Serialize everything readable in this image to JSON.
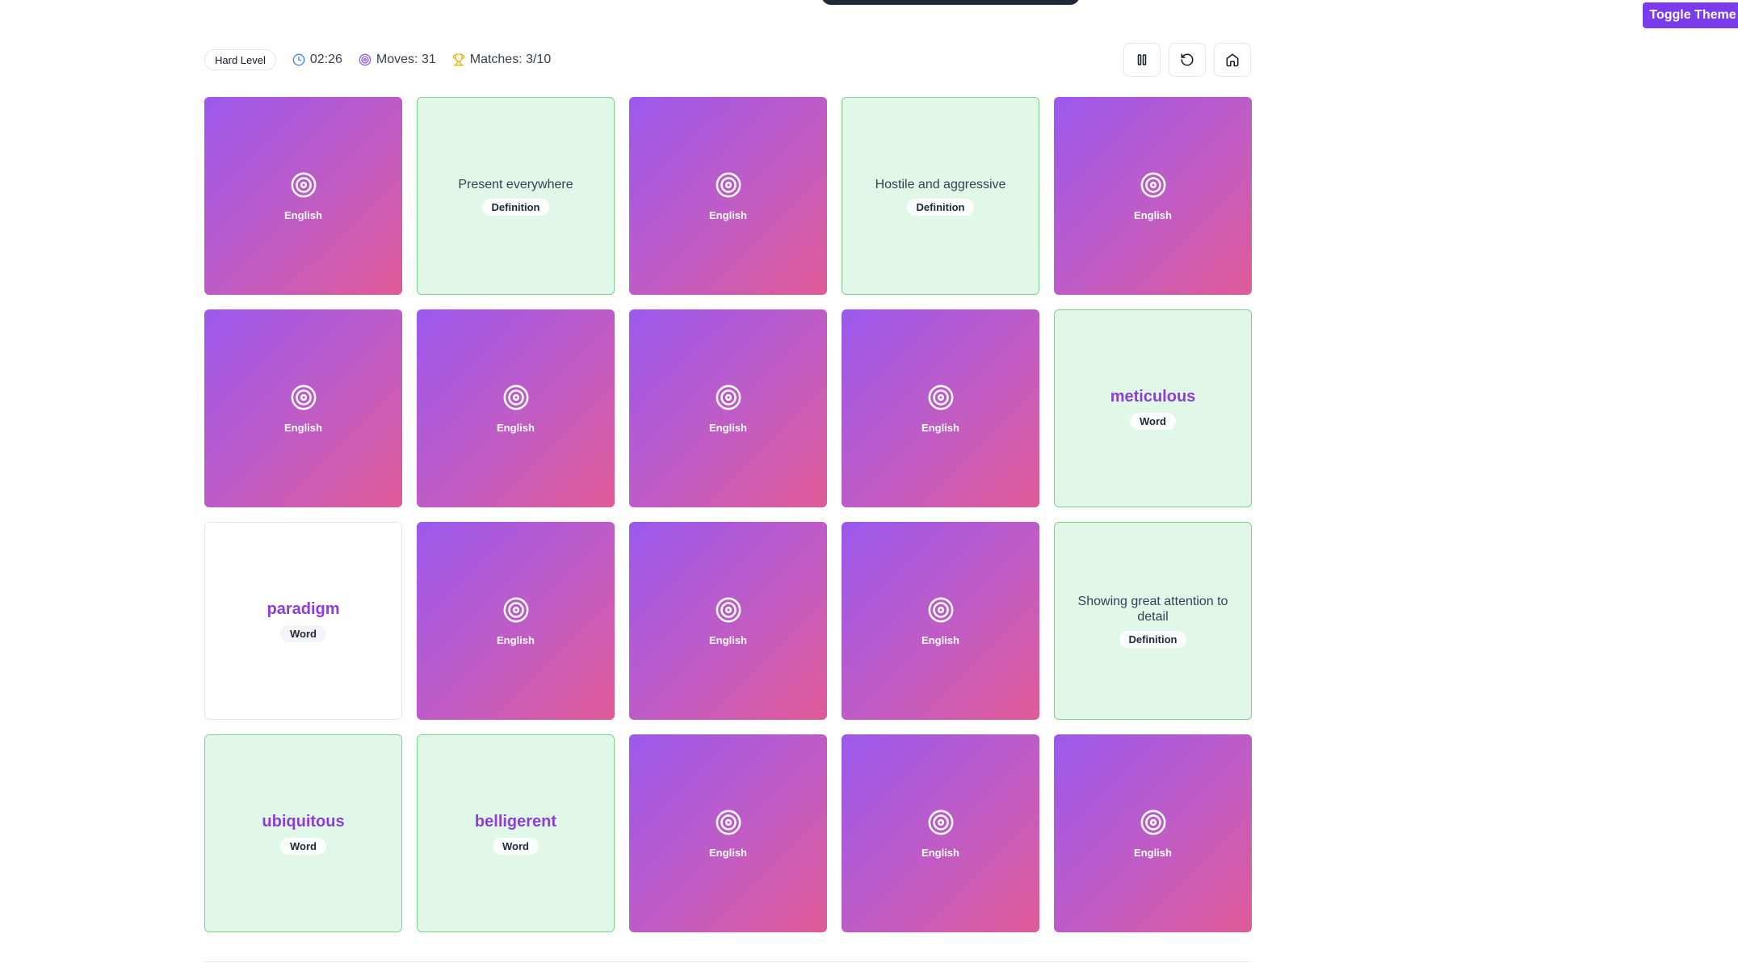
{
  "header": {
    "toggle_theme_label": "Toggle Theme",
    "level_label": "Hard Level",
    "timer": "02:26",
    "moves": "Moves: 31",
    "matches": "Matches: 3/10"
  },
  "controls": {
    "pause_icon": "pause-icon",
    "restart_icon": "restart-icon",
    "home_icon": "home-icon"
  },
  "colors": {
    "accent": "#7c3aed",
    "card_back_start": "#9b59ec",
    "card_back_end": "#e05b97",
    "matched_bg": "#e1f8e8",
    "matched_border": "#7fd18f",
    "word_text": "#8b3fd9"
  },
  "cards": [
    {
      "state": "back",
      "label": "English"
    },
    {
      "state": "matched",
      "kind": "definition",
      "text": "Present everywhere",
      "tag": "Definition"
    },
    {
      "state": "back",
      "label": "English"
    },
    {
      "state": "matched",
      "kind": "definition",
      "text": "Hostile and aggressive",
      "tag": "Definition"
    },
    {
      "state": "back",
      "label": "English"
    },
    {
      "state": "back",
      "label": "English"
    },
    {
      "state": "back",
      "label": "English"
    },
    {
      "state": "back",
      "label": "English"
    },
    {
      "state": "back",
      "label": "English"
    },
    {
      "state": "matched",
      "kind": "word",
      "text": "meticulous",
      "tag": "Word"
    },
    {
      "state": "flipped",
      "kind": "word",
      "text": "paradigm",
      "tag": "Word"
    },
    {
      "state": "back",
      "label": "English"
    },
    {
      "state": "back",
      "label": "English"
    },
    {
      "state": "back",
      "label": "English"
    },
    {
      "state": "matched",
      "kind": "definition",
      "text": "Showing great attention to detail",
      "tag": "Definition"
    },
    {
      "state": "matched",
      "kind": "word",
      "text": "ubiquitous",
      "tag": "Word"
    },
    {
      "state": "matched",
      "kind": "word",
      "text": "belligerent",
      "tag": "Word"
    },
    {
      "state": "back",
      "label": "English"
    },
    {
      "state": "back",
      "label": "English"
    },
    {
      "state": "back",
      "label": "English"
    }
  ]
}
